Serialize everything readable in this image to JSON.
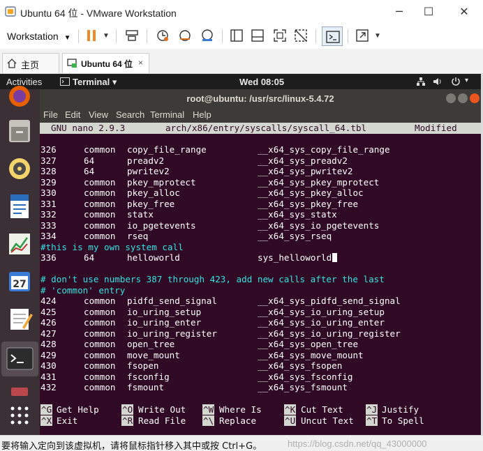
{
  "window": {
    "title": "Ubuntu 64 位 - VMware Workstation",
    "controls": {
      "minimize": "─",
      "maximize": "☐",
      "close": "✕"
    }
  },
  "toolbar": {
    "menu_label": "Workstation",
    "menu_arrow": "▼",
    "icons": [
      "pause-icon",
      "send-ctrl-alt-del-icon",
      "snapshot-icon",
      "revert-snapshot-icon",
      "snapshot-manager-icon",
      "library-icon",
      "thumbnail-icon",
      "fullscreen-icon",
      "unity-icon",
      "console-view-icon",
      "stretch-icon"
    ]
  },
  "tabs": [
    {
      "label": "主页",
      "icon": "home-icon",
      "active": false
    },
    {
      "label": "Ubuntu 64 位",
      "icon": "vm-icon",
      "active": true,
      "close": "×"
    }
  ],
  "ubuntu_topbar": {
    "activities": "Activities",
    "app_menu": "Terminal ▾",
    "clock": "Wed 08:05",
    "system_icons": [
      "network-icon",
      "volume-icon",
      "power-icon"
    ]
  },
  "dock": [
    "firefox-icon",
    "files-icon",
    "rhythmbox-icon",
    "writer-icon",
    "calc-icon",
    "calendar-icon",
    "text-editor-icon",
    "terminal-icon"
  ],
  "terminal": {
    "title": "root@ubuntu: /usr/src/linux-5.4.72",
    "menu": [
      "File",
      "Edit",
      "View",
      "Search",
      "Terminal",
      "Help"
    ]
  },
  "nano": {
    "version": "GNU nano 2.9.3",
    "file": "arch/x86/entry/syscalls/syscall_64.tbl",
    "state": "Modified",
    "rows": [
      {
        "num": "326",
        "abi": "common",
        "name": "copy_file_range",
        "entry": "__x64_sys_copy_file_range"
      },
      {
        "num": "327",
        "abi": "64",
        "name": "preadv2",
        "entry": "__x64_sys_preadv2"
      },
      {
        "num": "328",
        "abi": "64",
        "name": "pwritev2",
        "entry": "__x64_sys_pwritev2"
      },
      {
        "num": "329",
        "abi": "common",
        "name": "pkey_mprotect",
        "entry": "__x64_sys_pkey_mprotect"
      },
      {
        "num": "330",
        "abi": "common",
        "name": "pkey_alloc",
        "entry": "__x64_sys_pkey_alloc"
      },
      {
        "num": "331",
        "abi": "common",
        "name": "pkey_free",
        "entry": "__x64_sys_pkey_free"
      },
      {
        "num": "332",
        "abi": "common",
        "name": "statx",
        "entry": "__x64_sys_statx"
      },
      {
        "num": "333",
        "abi": "common",
        "name": "io_pgetevents",
        "entry": "__x64_sys_io_pgetevents"
      },
      {
        "num": "334",
        "abi": "common",
        "name": "rseq",
        "entry": "__x64_sys_rseq"
      }
    ],
    "comment1": "#this is my own system call",
    "custom_row": {
      "num": "336",
      "abi": "64",
      "name": "helloworld",
      "entry": "sys_helloworld"
    },
    "comment2": "# don't use numbers 387 through 423, add new calls after the last",
    "comment3": "# 'common' entry",
    "rows2": [
      {
        "num": "424",
        "abi": "common",
        "name": "pidfd_send_signal",
        "entry": "__x64_sys_pidfd_send_signal"
      },
      {
        "num": "425",
        "abi": "common",
        "name": "io_uring_setup",
        "entry": "__x64_sys_io_uring_setup"
      },
      {
        "num": "426",
        "abi": "common",
        "name": "io_uring_enter",
        "entry": "__x64_sys_io_uring_enter"
      },
      {
        "num": "427",
        "abi": "common",
        "name": "io_uring_register",
        "entry": "__x64_sys_io_uring_register"
      },
      {
        "num": "428",
        "abi": "common",
        "name": "open_tree",
        "entry": "__x64_sys_open_tree"
      },
      {
        "num": "429",
        "abi": "common",
        "name": "move_mount",
        "entry": "__x64_sys_move_mount"
      },
      {
        "num": "430",
        "abi": "common",
        "name": "fsopen",
        "entry": "__x64_sys_fsopen"
      },
      {
        "num": "431",
        "abi": "common",
        "name": "fsconfig",
        "entry": "__x64_sys_fsconfig"
      },
      {
        "num": "432",
        "abi": "common",
        "name": "fsmount",
        "entry": "__x64_sys_fsmount"
      }
    ],
    "shortcuts": [
      {
        "key": "^G",
        "label": "Get Help"
      },
      {
        "key": "^O",
        "label": "Write Out"
      },
      {
        "key": "^W",
        "label": "Where Is"
      },
      {
        "key": "^K",
        "label": "Cut Text"
      },
      {
        "key": "^J",
        "label": "Justify"
      },
      {
        "key": "^X",
        "label": "Exit"
      },
      {
        "key": "^R",
        "label": "Read File"
      },
      {
        "key": "^\\",
        "label": "Replace"
      },
      {
        "key": "^U",
        "label": "Uncut Text"
      },
      {
        "key": "^T",
        "label": "To Spell"
      }
    ]
  },
  "statusbar": {
    "text": "要将输入定向到该虚拟机，请将鼠标指针移入其中或按 Ctrl+G。",
    "watermark": "https://blog.csdn.net/qq_43000000"
  }
}
